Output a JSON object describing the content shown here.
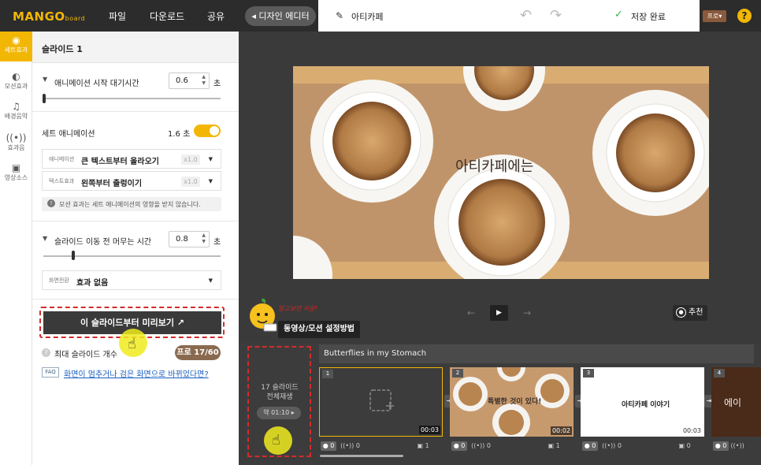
{
  "topbar": {
    "logo": "MANGO",
    "logo_sub": "board",
    "menu": [
      "파일",
      "다운로드",
      "공유"
    ],
    "design_editor": "◂ 디자인 에디터",
    "doc_title": "아티카페",
    "save_status": "저장 완료",
    "plan": "프로",
    "help": "?"
  },
  "sidebar": {
    "items": [
      {
        "label": "세트효과",
        "icon": "set-effect-icon"
      },
      {
        "label": "모션효과",
        "icon": "motion-effect-icon"
      },
      {
        "label": "배경음악",
        "icon": "music-note-icon"
      },
      {
        "label": "효과음",
        "icon": "sound-effect-icon"
      },
      {
        "label": "영상소스",
        "icon": "video-source-icon"
      }
    ]
  },
  "panel": {
    "title": "슬라이드 1",
    "wait_label": "애니메이션 시작 대기시간",
    "wait_value": "0.6",
    "unit": "초",
    "set_anim_label": "세트 애니메이션",
    "set_anim_value": "1.6 초",
    "anim_key": "애니메이션",
    "anim_value": "큰 텍스트부터 올라오기",
    "anim_speed": "x1.0",
    "text_key": "텍스트효과",
    "text_value": "왼쪽부터 출렁이기",
    "text_speed": "x1.0",
    "notice": "모션 효과는 세트 애니메이션의 영향을 받지 않습니다.",
    "stay_label": "슬라이드 이동 전 머무는 시간",
    "stay_value": "0.8",
    "transition_key": "화면전환",
    "transition_value": "효과 없음",
    "preview_button": "이 슬라이드부터 미리보기 ↗",
    "max_slides_label": "최대 슬라이드 개수",
    "max_slides_badge": "프로 17/60",
    "faq": "FAQ",
    "faq_link": "화면이 멈추거나 검은 화면으로 바뀌었다면?"
  },
  "canvas": {
    "slide_text": "아티카페에는",
    "recommend": "추천",
    "tooltip_red": "알고보면 쉬운!",
    "tooltip": "동영상/모션 설정방법"
  },
  "timeline": {
    "title": "Butterflies in my Stomach",
    "count_line1": "17 슬라이드",
    "count_line2": "전체재생",
    "total_time": "약 01:10 ▸",
    "slides": [
      {
        "num": "1",
        "duration": "00:03",
        "text": "",
        "c1": "0",
        "c2": "0",
        "c3": "1"
      },
      {
        "num": "2",
        "duration": "00:02",
        "text": "특별한 것이 있다!",
        "c1": "0",
        "c2": "0",
        "c3": "1"
      },
      {
        "num": "3",
        "duration": "00:03",
        "text": "아티카페 이야기",
        "c1": "0",
        "c2": "0",
        "c3": "0"
      },
      {
        "num": "4",
        "duration": "",
        "text": "에이",
        "c1": "0",
        "c2": "",
        "c3": ""
      }
    ]
  },
  "colors": {
    "accent": "#f2b705",
    "dark": "#2c2c2c",
    "highlight_red": "#d42b2b"
  }
}
